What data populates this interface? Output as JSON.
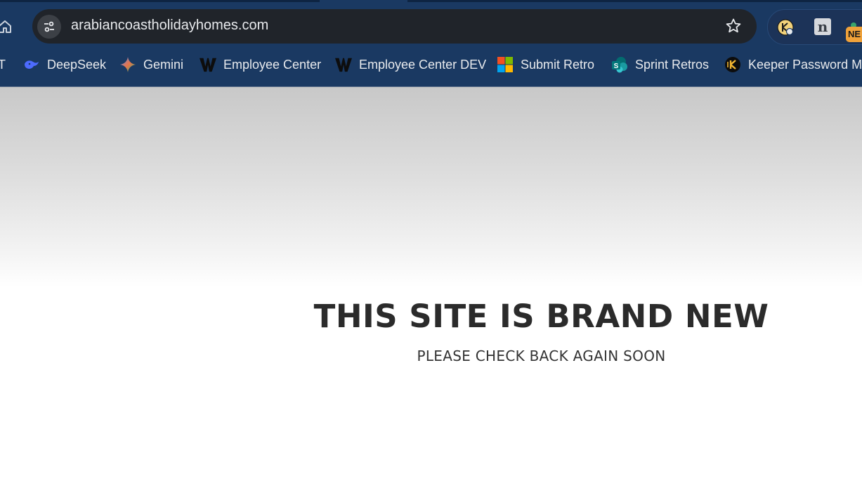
{
  "browser": {
    "url": "arabiancoastholidayhomes.com",
    "home_icon": "home-icon",
    "site_info_icon": "tune-icon",
    "bookmark_star_icon": "star-icon",
    "extensions": {
      "keeper_icon": "keeper-icon",
      "notion_icon": "notion-icon",
      "notion_glyph": "n",
      "new_badge": "NE"
    }
  },
  "bookmarks": [
    {
      "label": "T",
      "icon": "partial-bookmark"
    },
    {
      "label": "DeepSeek",
      "icon": "deepseek-whale-icon"
    },
    {
      "label": "Gemini",
      "icon": "gemini-sparkle-icon"
    },
    {
      "label": "Employee Center",
      "icon": "w-logo-icon"
    },
    {
      "label": "Employee Center DEV",
      "icon": "w-logo-icon"
    },
    {
      "label": "Submit Retro",
      "icon": "microsoft-icon"
    },
    {
      "label": "Sprint Retros",
      "icon": "sharepoint-icon"
    },
    {
      "label": "Keeper Password M...",
      "icon": "keeper-icon"
    }
  ],
  "page": {
    "headline": "THIS SITE IS BRAND NEW",
    "subline": "PLEASE CHECK BACK AGAIN SOON"
  },
  "colors": {
    "chrome_bg": "#1a3962",
    "omnibox_bg": "#20242a",
    "text_dark": "#2b2b2b"
  }
}
